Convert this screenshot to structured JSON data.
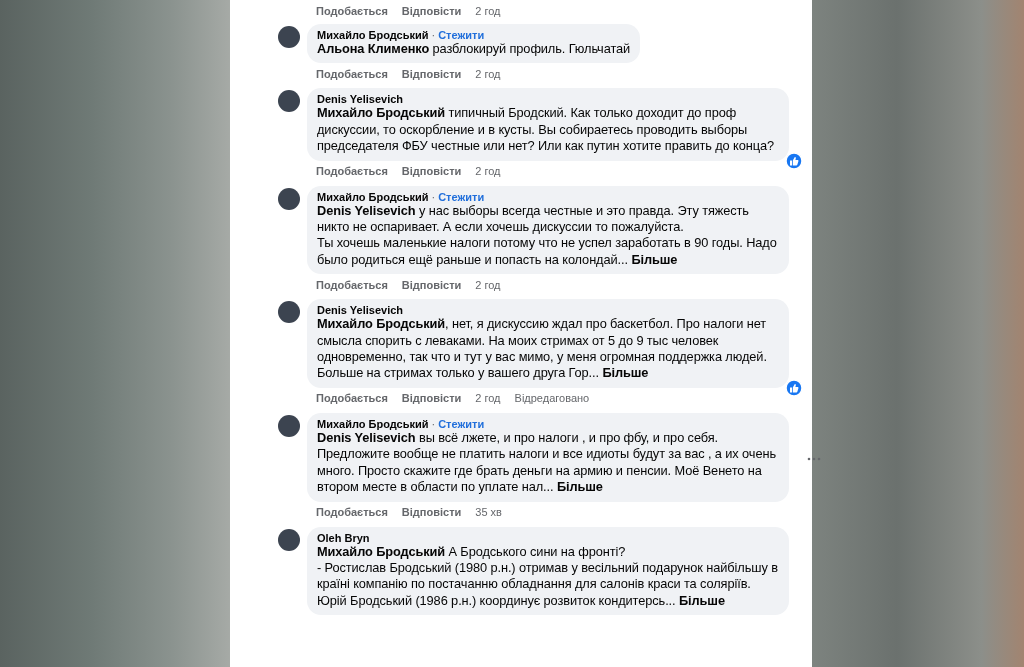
{
  "top_actions": {
    "like": "Подобається",
    "reply": "Відповісти",
    "time": "2 год"
  },
  "comments": [
    {
      "author": "Михайло Бродський",
      "separator": "·",
      "follow": "Стежити",
      "paragraphs": [
        "**Альона Клименко** разблокируй профиль. Гюльчатай"
      ],
      "reaction": false,
      "options": false,
      "actions": {
        "like": "Подобається",
        "reply": "Відповісти",
        "time": "2 год"
      }
    },
    {
      "author": "Denis Yelisevich",
      "paragraphs": [
        "**Михайло Бродський** типичный Бродский. Как только доходит до проф дискуссии, то оскорбление и в кусты. Вы собираетесь проводить выборы председателя ФБУ честные или нет? Или как путин хотите править до конца?"
      ],
      "reaction": true,
      "options": false,
      "actions": {
        "like": "Подобається",
        "reply": "Відповісти",
        "time": "2 год"
      }
    },
    {
      "author": "Михайло Бродський",
      "separator": "·",
      "follow": "Стежити",
      "paragraphs": [
        "**Denis Yelisevich** у нас выборы всегда честные и это правда. Эту тяжесть никто не оспаривает. А если хочешь дискуссии то пожалуйста.",
        "Ты хочешь маленькие налоги потому что не успел заработать в 90 годы. Надо было родиться ещё раньше и попасть на колондай..."
      ],
      "more": "Більше",
      "reaction": false,
      "options": false,
      "actions": {
        "like": "Подобається",
        "reply": "Відповісти",
        "time": "2 год"
      }
    },
    {
      "author": "Denis Yelisevich",
      "paragraphs": [
        "**Михайло Бродський**, нет, я дискуссию ждал про баскетбол. Про налоги нет смысла спорить с леваками. На моих стримах от 5 до 9 тыс человек одновременно, так что и тут у вас мимо, у меня огромная поддержка людей. Больше на стримах только у вашего друга Гор..."
      ],
      "more": "Більше",
      "reaction": true,
      "options": false,
      "actions": {
        "like": "Подобається",
        "reply": "Відповісти",
        "time": "2 год",
        "edited": "Відредаговано"
      }
    },
    {
      "author": "Михайло Бродський",
      "separator": "·",
      "follow": "Стежити",
      "paragraphs": [
        "**Denis Yelisevich** вы всё лжете, и про налоги , и про фбу, и про себя. Предложите вообще не платить налоги и все идиоты будут за вас , а их очень много. Просто скажите где брать деньги на армию и пенсии. Моё Венето на втором месте в области по уплате нал..."
      ],
      "more": "Більше",
      "reaction": false,
      "options": true,
      "actions": {
        "like": "Подобається",
        "reply": "Відповісти",
        "time": "35 хв"
      }
    },
    {
      "author": "Oleh Bryn",
      "paragraphs": [
        "**Михайло Бродський** А Бродського сини на фронті?",
        "- Ростислав Бродський (1980 р.н.) отримав у весільний подарунок найбільшу в країні компанію по постачанню обладнання для салонів краси та соляріїв.",
        "Юрій Бродський (1986 р.н.) координує розвиток кондитерсь..."
      ],
      "more": "Більше",
      "reaction": false,
      "options": false
    }
  ]
}
